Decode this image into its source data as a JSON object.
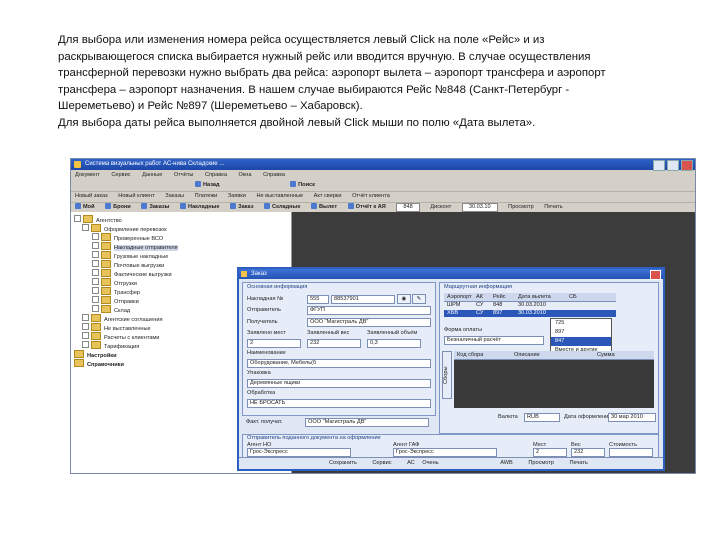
{
  "paragraph": {
    "lines": [
      "Для выбора или изменения номера рейса осуществляется левый Click на поле «Рейс» и из",
      "раскрывающегося списка выбирается нужный рейс или вводится вручную. В случае осуществления",
      "трансферной перевозки нужно выбрать два рейса: аэропорт вылета – аэропорт трансфера и аэропорт",
      "трансфера – аэропорт назначения. В нашем случае выбираются Рейс №848 (Санкт-Петербург -",
      "Шереметьево) и Рейс №897 (Шереметьево – Хабаровск).",
      "Для выбора даты рейса выполняется двойной левый Click мыши по полю «Дата вылета»."
    ]
  },
  "app": {
    "title": "Система визуальных работ АС-нива Складские ...",
    "menu": [
      "Документ",
      "Сервис",
      "Данные",
      "Отчёты",
      "Справка",
      "Окна",
      "Справка"
    ],
    "toolbar1": [
      "Назад",
      "Поиск"
    ],
    "toolbar2": [
      "Новый заказ",
      "Новый клиент",
      "Заказы",
      "Платежи",
      "Заявки",
      "Не выставленные",
      "Акт сверки",
      "Отчёт клиента"
    ],
    "toolbar3": {
      "items": [
        "Мой",
        "Брони",
        "Заказы",
        "Накладные",
        "Заказ",
        "Складные",
        "Вылет",
        "Отчёт к АЯ",
        "Дисконт"
      ],
      "combo1": "848",
      "combo2": "30.03.10",
      "right": "Просмотр",
      "right2": "Печать"
    }
  },
  "tree": {
    "items": [
      {
        "label": "Агентство",
        "level": 0,
        "bold": false
      },
      {
        "label": "Оформление перевозок",
        "level": 1,
        "bold": false
      },
      {
        "label": "Проверенные ВСО",
        "level": 2,
        "bold": false
      },
      {
        "label": "Накладные отправителя",
        "level": 2,
        "bold": false,
        "selected": true
      },
      {
        "label": "Грузовые накладные",
        "level": 2,
        "bold": false
      },
      {
        "label": "Почтовые выгрузки",
        "level": 2,
        "bold": false
      },
      {
        "label": "Фактические выгрузки",
        "level": 2,
        "bold": false
      },
      {
        "label": "Отгрузки",
        "level": 2,
        "bold": false
      },
      {
        "label": "Трансфер",
        "level": 2,
        "bold": false
      },
      {
        "label": "Отправки",
        "level": 2,
        "bold": false
      },
      {
        "label": "Склад",
        "level": 2,
        "bold": false
      },
      {
        "label": "Агентские соглашения",
        "level": 1,
        "bold": false
      },
      {
        "label": "Не выставленные",
        "level": 1,
        "bold": false
      },
      {
        "label": "Расчеты с клиентами",
        "level": 1,
        "bold": false
      },
      {
        "label": "Тарификация",
        "level": 1,
        "bold": false
      },
      {
        "label": "Настройки",
        "level": 0,
        "bold": true
      },
      {
        "label": "Справочники",
        "level": 0,
        "bold": true
      }
    ]
  },
  "dialog": {
    "title": "Заказ",
    "main_group": "Основная информация",
    "nakl_label": "Накладная №",
    "nakl_prefix": "555",
    "nakl_value": "88537901",
    "sender_label": "Отправитель",
    "sender_value": "ФГУП",
    "receiver_label": "Получатель",
    "receiver_value": "ООО \"Магистраль ДВ\"",
    "places_label": "Заявлено мест",
    "weight_label": "Заявленный вес",
    "volume_label": "Заявленный объём",
    "places_value": "2",
    "weight_value": "232",
    "volume_value": "0,3",
    "naming_label": "Наименование",
    "naming_value": "Оборудование, Мебель(б",
    "pack_label": "Упаковка",
    "pack_value": "Деревянные ящики",
    "processing_label": "Обработка",
    "processing_value": "НЕ БРОСАТЬ",
    "payer_label": "Факт. получат.",
    "payer_value": "ООО \"Магистраль ДВ\"",
    "route_group": "Маршрутная информация",
    "route_headers": [
      "Аэропорт",
      "АК",
      "Рейс",
      "Дата вылета",
      "СБ"
    ],
    "route_rows": [
      [
        "ШРМ",
        "СУ",
        "848",
        "30.03.2010",
        ""
      ],
      [
        "ХБВ",
        "СУ",
        "897",
        "30.03.2010",
        ""
      ]
    ],
    "flight_options": [
      "725",
      "897",
      "847",
      "Вместе и другие"
    ],
    "pay_form_label": "Форма оплаты",
    "pay_form_value": "Безналичный расчёт",
    "goods_headers": [
      "Код сбора",
      "Описание",
      "Сумма"
    ],
    "vtab_label": "Сборы",
    "currency_label": "Валюта",
    "currency_value": "RUB",
    "date_label": "Дата оформления",
    "date_value": "30 мар 2010",
    "agent_group": "Отправитель поданного документа на оформление",
    "agent_headers": [
      "Агент НО",
      "Агент ГАФ",
      "Мест",
      "Вес",
      "Стоимость"
    ],
    "agent_values": [
      "Грос-Экспресс",
      "Грос-Экспресс",
      "2",
      "232",
      ""
    ],
    "status_items": [
      "Сохранить",
      "Сервис",
      "АС",
      "Очень",
      "AWB",
      "Просмотр",
      "Печать"
    ]
  }
}
